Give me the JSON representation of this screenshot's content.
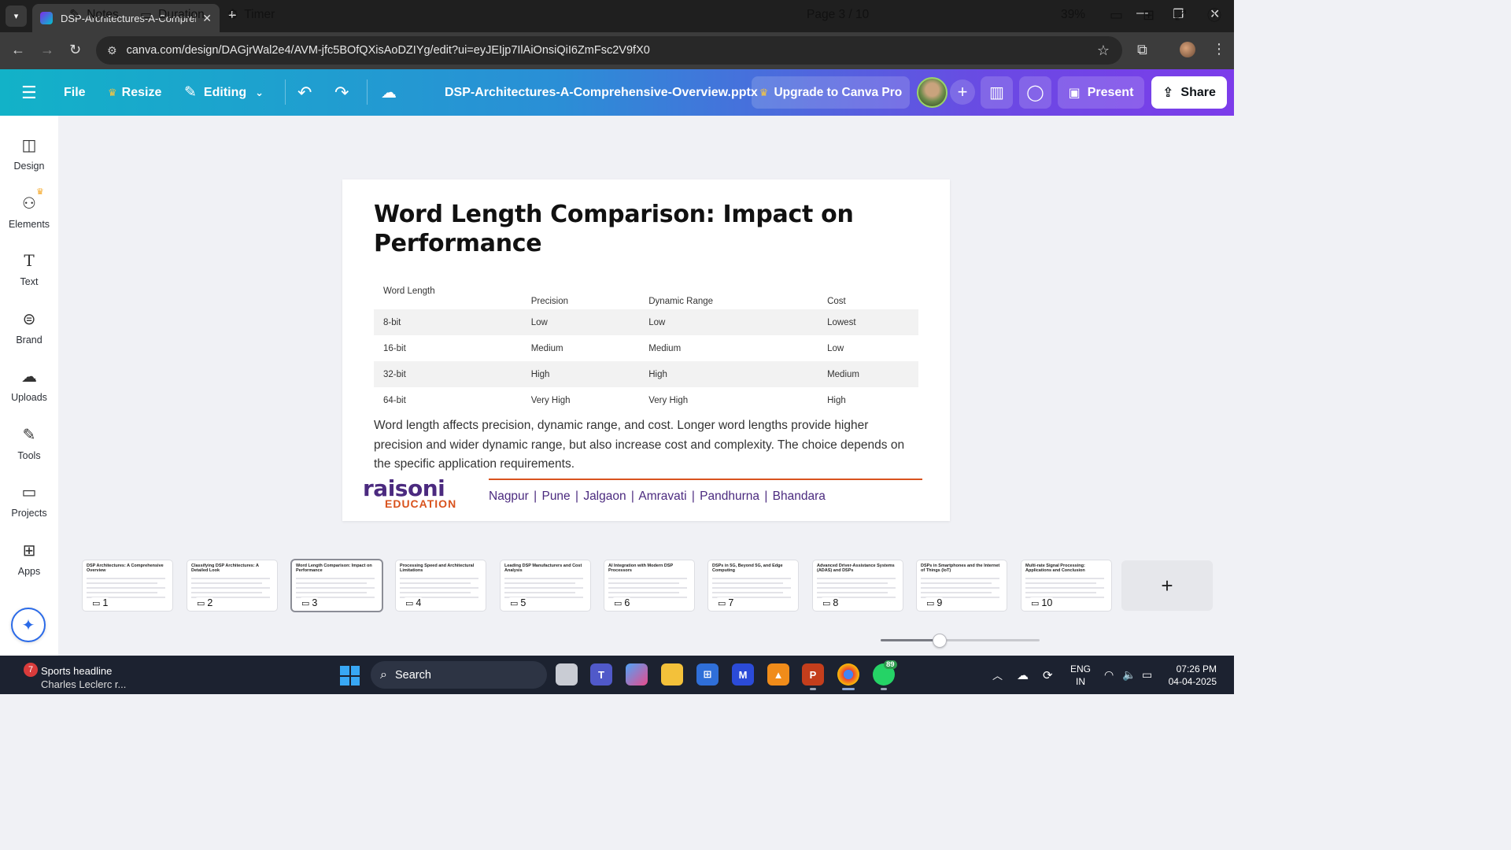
{
  "browser": {
    "tab_title": "DSP-Architectures-A-Compreh",
    "url": "canva.com/design/DAGjrWal2e4/AVM-jfc5BOfQXisAoDZIYg/edit?ui=eyJEIjp7IlAiOnsiQiI6ZmFsc2V9fX0"
  },
  "toolbar": {
    "file": "File",
    "resize": "Resize",
    "editing": "Editing",
    "doc_title": "DSP-Architectures-A-Comprehensive-Overview.pptx",
    "upgrade": "Upgrade to Canva Pro",
    "present": "Present",
    "share": "Share"
  },
  "sidebar": {
    "items": [
      {
        "label": "Design",
        "icon": "design-icon"
      },
      {
        "label": "Elements",
        "icon": "elements-icon"
      },
      {
        "label": "Text",
        "icon": "text-icon"
      },
      {
        "label": "Brand",
        "icon": "brand-icon"
      },
      {
        "label": "Uploads",
        "icon": "uploads-icon"
      },
      {
        "label": "Tools",
        "icon": "tools-icon"
      },
      {
        "label": "Projects",
        "icon": "projects-icon"
      },
      {
        "label": "Apps",
        "icon": "apps-icon"
      }
    ]
  },
  "slide": {
    "title": "Word Length Comparison: Impact on Performance",
    "table": {
      "headers": [
        "Word Length",
        "Precision",
        "Dynamic Range",
        "Cost"
      ],
      "rows": [
        [
          "8-bit",
          "Low",
          "Low",
          "Lowest"
        ],
        [
          "16-bit",
          "Medium",
          "Medium",
          "Low"
        ],
        [
          "32-bit",
          "High",
          "High",
          "Medium"
        ],
        [
          "64-bit",
          "Very High",
          "Very High",
          "High"
        ]
      ]
    },
    "body": "Word length affects precision, dynamic range, and cost. Longer word lengths provide higher precision and wider dynamic range, but also increase cost and complexity. The choice depends on the specific application requirements.",
    "logo_main": "raisoni",
    "logo_sub": "EDUCATION",
    "cities": "Nagpur | Pune | Jalgaon | Amravati | Pandhurna | Bhandara"
  },
  "filmstrip": [
    {
      "num": "1",
      "title": "DSP Architectures: A Comprehensive Overview"
    },
    {
      "num": "2",
      "title": "Classifying DSP Architectures: A Detailed Look"
    },
    {
      "num": "3",
      "title": "Word Length Comparison: Impact on Performance"
    },
    {
      "num": "4",
      "title": "Processing Speed and Architectural Limitations"
    },
    {
      "num": "5",
      "title": "Leading DSP Manufacturers and Cost Analysis"
    },
    {
      "num": "6",
      "title": "AI Integration with Modern DSP Processors"
    },
    {
      "num": "7",
      "title": "DSPs in 5G, Beyond 5G, and Edge Computing"
    },
    {
      "num": "8",
      "title": "Advanced Driver-Assistance Systems (ADAS) and DSPs"
    },
    {
      "num": "9",
      "title": "DSPs in Smartphones and the Internet of Things (IoT)"
    },
    {
      "num": "10",
      "title": "Multi-rate Signal Processing: Applications and Conclusion"
    }
  ],
  "selected_slide": 3,
  "bottom": {
    "notes": "Notes",
    "duration": "Duration",
    "timer": "Timer",
    "page": "Page 3 / 10",
    "zoom": "39%",
    "zoom_fraction": 0.39
  },
  "taskbar": {
    "news_badge": "7",
    "news_headline": "Sports headline",
    "news_sub": "Charles Leclerc r...",
    "search": "Search",
    "whatsapp_badge": "89",
    "lang1": "ENG",
    "lang2": "IN",
    "time": "07:26 PM",
    "date": "04-04-2025"
  },
  "colors": {
    "canva_gradient_start": "#12b2c8",
    "canva_gradient_end": "#7c3cea",
    "brand_purple": "#4b2a7f",
    "brand_orange": "#d9531e"
  }
}
